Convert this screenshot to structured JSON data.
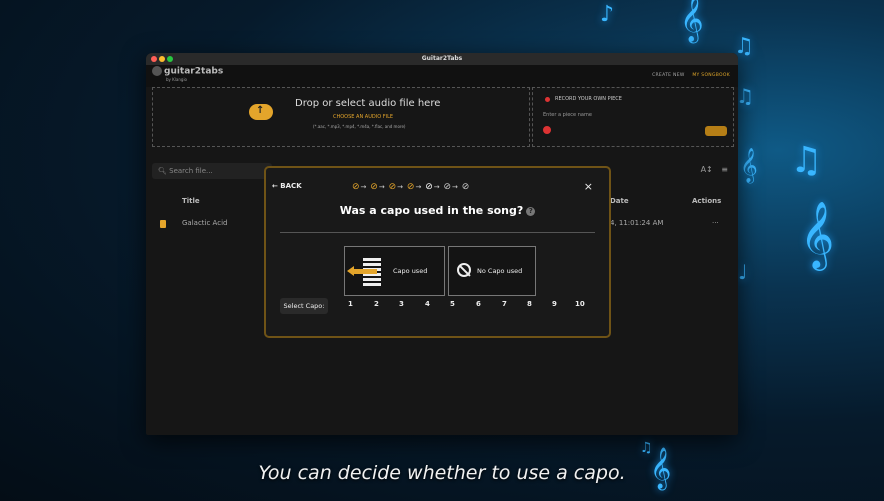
{
  "window": {
    "title": "Guitar2Tabs"
  },
  "app": {
    "logo_name": "guitar2tabs",
    "logo_sub": "by Klangio",
    "nav": [
      "CREATE NEW",
      "MY SONGBOOK"
    ]
  },
  "upload": {
    "headline": "Drop or select audio file here",
    "choose_label": "CHOOSE AN AUDIO FILE",
    "formats": "(*.aac, *.mp3, *.mp4, *.m4a, *.flac, and more)"
  },
  "record": {
    "title": "RECORD YOUR OWN PIECE",
    "placeholder": "Enter a piece name"
  },
  "search": {
    "placeholder": "Search file..."
  },
  "table": {
    "headers": {
      "title": "Title",
      "date": "Date",
      "actions": "Actions"
    },
    "rows": [
      {
        "title": "Galactic Acid",
        "date": "4, 11:01:24 AM",
        "actions": "···"
      }
    ]
  },
  "modal": {
    "back_label": "← BACK",
    "close_label": "×",
    "steps": [
      "done",
      "done",
      "done",
      "done",
      "current",
      "todo",
      "todo"
    ],
    "question": "Was a capo used in the song?",
    "help_icon": "?",
    "option_capo": "Capo used",
    "option_no_capo": "No Capo used",
    "select_capo_label": "Select Capo:",
    "capo_numbers": [
      "1",
      "2",
      "3",
      "4",
      "5",
      "6",
      "7",
      "8",
      "9",
      "10"
    ]
  },
  "caption": "You can decide whether to use a capo.",
  "colors": {
    "accent": "#e4a52b",
    "background": "#071a2a"
  }
}
